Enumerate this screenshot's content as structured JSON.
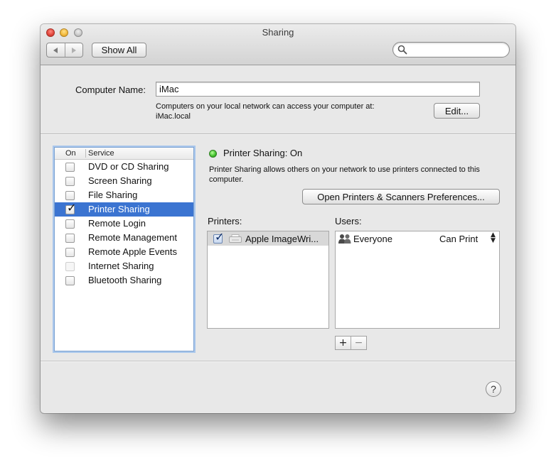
{
  "window": {
    "title": "Sharing",
    "toolbar": {
      "show_all_label": "Show All",
      "search_placeholder": ""
    }
  },
  "computer_name": {
    "label": "Computer Name:",
    "value": "iMac",
    "description_line1": "Computers on your local network can access your computer at:",
    "description_line2": "iMac.local",
    "edit_label": "Edit..."
  },
  "services": {
    "header_on": "On",
    "header_service": "Service",
    "items": [
      {
        "label": "DVD or CD Sharing",
        "checked": false,
        "enabled": true,
        "selected": false
      },
      {
        "label": "Screen Sharing",
        "checked": false,
        "enabled": true,
        "selected": false
      },
      {
        "label": "File Sharing",
        "checked": false,
        "enabled": true,
        "selected": false
      },
      {
        "label": "Printer Sharing",
        "checked": true,
        "enabled": true,
        "selected": true
      },
      {
        "label": "Remote Login",
        "checked": false,
        "enabled": true,
        "selected": false
      },
      {
        "label": "Remote Management",
        "checked": false,
        "enabled": true,
        "selected": false
      },
      {
        "label": "Remote Apple Events",
        "checked": false,
        "enabled": true,
        "selected": false
      },
      {
        "label": "Internet Sharing",
        "checked": false,
        "enabled": false,
        "selected": false
      },
      {
        "label": "Bluetooth Sharing",
        "checked": false,
        "enabled": true,
        "selected": false
      }
    ]
  },
  "detail": {
    "status": "Printer Sharing: On",
    "status_color": "#3fbe2a",
    "description": "Printer Sharing allows others on your network to use printers connected to this computer.",
    "open_prefs_label": "Open Printers & Scanners Preferences...",
    "printers_label": "Printers:",
    "users_label": "Users:",
    "printers": [
      {
        "name": "Apple ImageWri...",
        "checked": true,
        "icon": "printer-icon"
      }
    ],
    "users": [
      {
        "name": "Everyone",
        "permission": "Can Print",
        "icon": "group-icon"
      }
    ],
    "add_label": "+",
    "remove_label": "−"
  },
  "help_label": "?",
  "accent_color": "#3b74d1"
}
